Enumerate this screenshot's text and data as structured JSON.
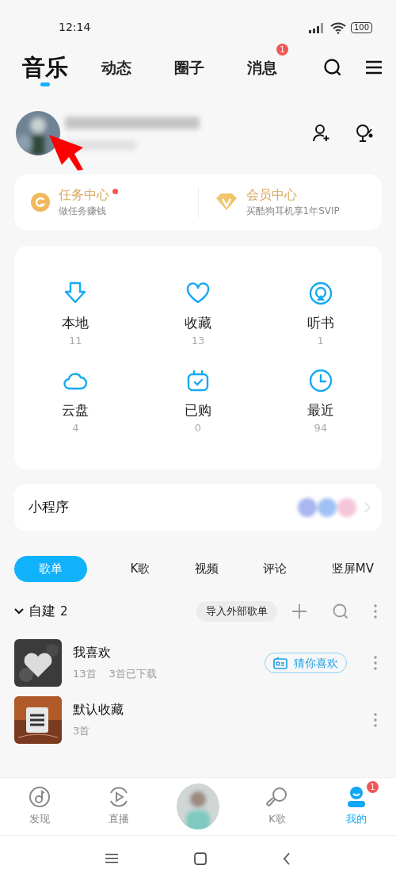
{
  "status_bar": {
    "time": "12:14",
    "battery": "100"
  },
  "top_tabs": [
    {
      "label": "音乐",
      "selected": true
    },
    {
      "label": "动态",
      "selected": false
    },
    {
      "label": "圈子",
      "selected": false
    },
    {
      "label": "消息",
      "selected": false,
      "badge": "1"
    }
  ],
  "promo_cards": [
    {
      "kind": "task",
      "title": "任务中心",
      "subtitle": "做任务赚钱",
      "dot": true
    },
    {
      "kind": "vip",
      "title": "会员中心",
      "subtitle": "买酷狗耳机享1年SVIP"
    }
  ],
  "grid": [
    {
      "kind": "download",
      "label": "本地",
      "count": "11"
    },
    {
      "kind": "heart",
      "label": "收藏",
      "count": "13"
    },
    {
      "kind": "audiobook",
      "label": "听书",
      "count": "1"
    },
    {
      "kind": "cloud",
      "label": "云盘",
      "count": "4"
    },
    {
      "kind": "bag",
      "label": "已购",
      "count": "0"
    },
    {
      "kind": "clock",
      "label": "最近",
      "count": "94"
    }
  ],
  "mini_program": {
    "title": "小程序"
  },
  "content_tabs": [
    {
      "label": "歌单",
      "selected": true
    },
    {
      "label": "K歌",
      "selected": false
    },
    {
      "label": "视频",
      "selected": false
    },
    {
      "label": "评论",
      "selected": false
    },
    {
      "label": "竖屏MV",
      "selected": false
    }
  ],
  "section": {
    "title": "自建",
    "count": "2",
    "expanded": true,
    "import_button": "导入外部歌单"
  },
  "playlists": [
    {
      "kind": "heart",
      "name": "我喜欢",
      "meta": [
        "13首",
        "3首已下载"
      ],
      "action": "猜你喜欢"
    },
    {
      "kind": "list",
      "name": "默认收藏",
      "meta": [
        "3首"
      ]
    }
  ],
  "bottom_nav": [
    {
      "kind": "disc",
      "label": "发现",
      "selected": false
    },
    {
      "kind": "play",
      "label": "直播",
      "selected": false
    },
    {
      "kind": "avatar"
    },
    {
      "kind": "mic",
      "label": "K歌",
      "selected": false
    },
    {
      "kind": "user",
      "label": "我的",
      "selected": true,
      "badge": "1"
    }
  ]
}
